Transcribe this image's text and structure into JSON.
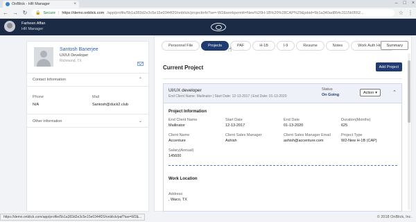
{
  "browser": {
    "tab_title": "OnBlick - HR Manager",
    "secure_label": "Secure",
    "url_host": "https://demo.onblick.com",
    "url_path": "/app/profile/5b1a383d2e3c5e15e0344f20/onblick/projectinfo?se=-W2&workpermit=New%20H-1B%20%28CAP%29&jobid=5b1a340ad864c3115b0552..."
  },
  "header": {
    "user_name": "Farheen Affan",
    "user_role": "HR Manager"
  },
  "profile": {
    "name": "Santosh Banerjee",
    "title": "UX/UI Developer",
    "location": "Richmond, TX",
    "contact_section": "Contact Information",
    "phone_label": "Phone",
    "phone_value": "N/A",
    "mail_label": "Mail",
    "mail_value": "Santosh@duck2.club",
    "other_section": "Other information"
  },
  "tabs": [
    "Personnel File",
    "Projects",
    "PAF",
    "H-1B",
    "I-9",
    "Resume",
    "Notes",
    "Work Auth History"
  ],
  "active_tab": "Projects",
  "summary_label": "Summary",
  "main": {
    "section_title": "Current Project",
    "add_project_label": "Add Project"
  },
  "project": {
    "name": "UI/UX developer",
    "meta": "End Client Name: Mailinator | Start Date: 12-13-2017 | End Date: 01-13-2020",
    "status_label": "Status",
    "status_value": "On Going",
    "action_label": "Action",
    "info_title": "Project Information",
    "fields": {
      "end_client_name_label": "End Client Name",
      "end_client_name_value": "Mailinator",
      "start_date_label": "Start Date",
      "start_date_value": "12-13-2017",
      "end_date_label": "End Date",
      "end_date_value": "01-13-2020",
      "duration_label": "Duration(Months)",
      "duration_value": "625",
      "client_name_label": "Client Name",
      "client_name_value": "Accenture",
      "client_sales_manager_label": "Client Sales Manager",
      "client_sales_manager_value": "Ashish",
      "client_sales_manager_email_label": "Client Sales Manager Email",
      "client_sales_manager_email_value": "ashish@accenture.com",
      "project_type_label": "Project Type",
      "project_type_value": "W2-New H-1B (CAP)",
      "salary_label": "Salary(Annual)",
      "salary_value": "145600"
    },
    "work_location_title": "Work Location",
    "address_label": "Address",
    "address_value": ", Waco, TX"
  },
  "statusbar_url": "https://demo.onblick.com/app/profile/5b1a383d2e3c5e15e0344f20/onblick/paf?tax=W2&...",
  "copyright": "© 2018 OnBlick, Inc.",
  "colors": {
    "header_bg": "#1c2b45",
    "accent": "#1f3b70",
    "link": "#2b5db8"
  }
}
